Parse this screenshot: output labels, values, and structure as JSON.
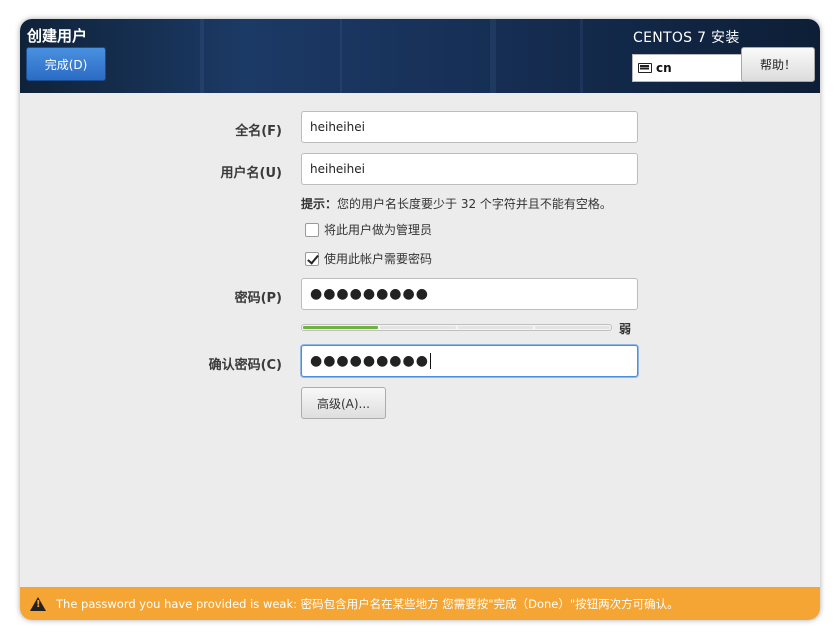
{
  "header": {
    "title": "创建用户",
    "done_label": "完成(D)",
    "product": "CENTOS 7 安装",
    "keyboard_layout": "cn",
    "help_label": "帮助！"
  },
  "form": {
    "fullname_label": "全名(F)",
    "fullname_value": "heiheihei",
    "username_label": "用户名(U)",
    "username_value": "heiheihei",
    "hint_bold": "提示：",
    "hint_text": "您的用户名长度要少于 32 个字符并且不能有空格。",
    "admin_check_label": "将此用户做为管理员",
    "admin_checked": false,
    "require_password_label": "使用此帐户需要密码",
    "require_password_checked": true,
    "password_label": "密码(P)",
    "password_value": "●●●●●●●●●",
    "strength_fraction": 0.25,
    "strength_text": "弱",
    "strength_color": "#6fb23f",
    "confirm_label": "确认密码(C)",
    "confirm_value": "●●●●●●●●●",
    "advanced_label": "高级(A)..."
  },
  "infobar": {
    "icon": "warning-icon",
    "message": "The password you have provided is weak: 密码包含用户名在某些地方 您需要按\"完成（Done）\"按钮两次方可确认。",
    "color": "#f5a533"
  }
}
